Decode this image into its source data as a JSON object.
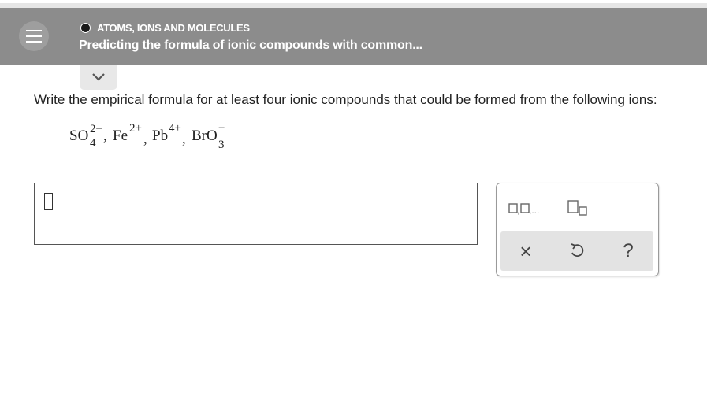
{
  "header": {
    "topic": "ATOMS, IONS AND MOLECULES",
    "title": "Predicting the formula of ionic compounds with common..."
  },
  "question": {
    "text": "Write the empirical formula for at least four ionic compounds that could be formed from the following ions:",
    "ions": [
      {
        "base": "SO",
        "sub": "4",
        "sup": "2−"
      },
      {
        "base": "Fe",
        "sub": "",
        "sup": "2+"
      },
      {
        "base": "Pb",
        "sub": "",
        "sup": "4+"
      },
      {
        "base": "BrO",
        "sub": "3",
        "sup": "−"
      }
    ],
    "separator": ","
  },
  "answer": {
    "value": ""
  },
  "palette": {
    "list_label": "□,□,...",
    "clear_label": "×",
    "undo_icon": "undo-icon",
    "help_label": "?"
  },
  "colors": {
    "header_bg": "#8c8c8c",
    "tab_bg": "#e8e8e8",
    "action_bar_bg": "#e3e3e3"
  }
}
